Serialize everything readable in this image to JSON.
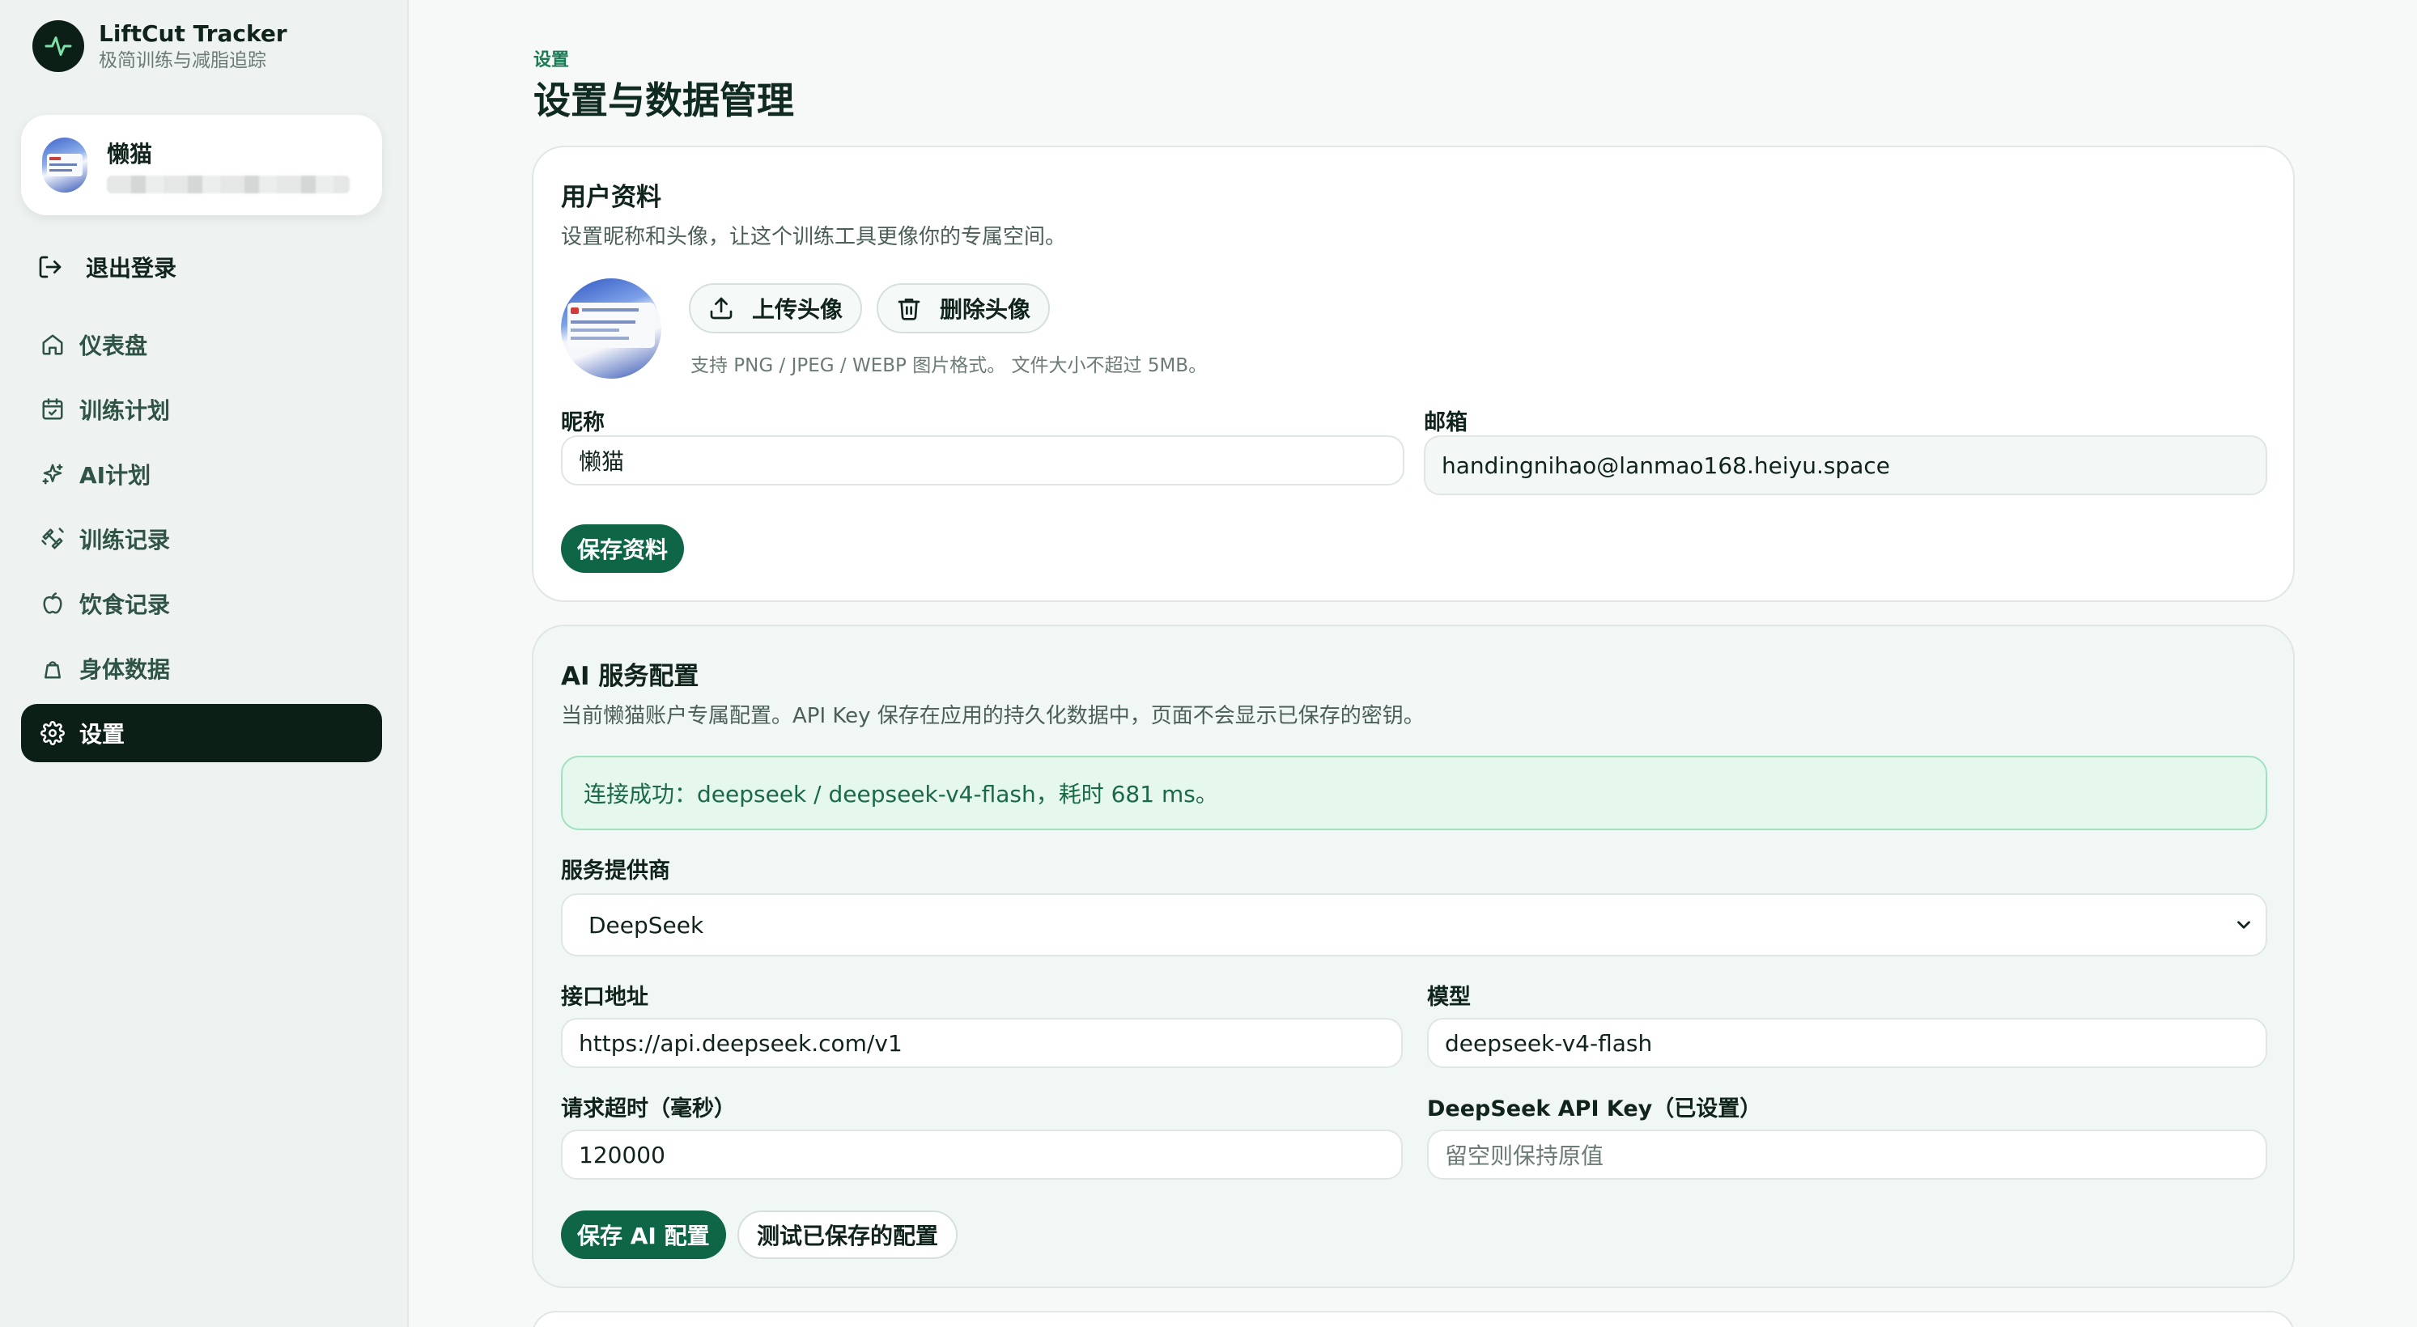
{
  "app": {
    "title": "LiftCut Tracker",
    "subtitle": "极简训练与减脂追踪"
  },
  "user": {
    "name": "懒猫"
  },
  "sidebar": {
    "logout_label": "退出登录",
    "items": [
      {
        "label": "仪表盘",
        "icon": "home-icon"
      },
      {
        "label": "训练计划",
        "icon": "calendar-icon"
      },
      {
        "label": "AI计划",
        "icon": "sparkle-icon"
      },
      {
        "label": "训练记录",
        "icon": "dumbbell-icon"
      },
      {
        "label": "饮食记录",
        "icon": "apple-icon"
      },
      {
        "label": "身体数据",
        "icon": "scale-icon"
      },
      {
        "label": "设置",
        "icon": "gear-icon",
        "active": true
      }
    ]
  },
  "page": {
    "breadcrumb": "设置",
    "title": "设置与数据管理"
  },
  "profile": {
    "title": "用户资料",
    "description": "设置昵称和头像，让这个训练工具更像你的专属空间。",
    "upload_label": "上传头像",
    "delete_label": "删除头像",
    "hint": "支持 PNG / JPEG / WEBP 图片格式。 文件大小不超过 5MB。",
    "nickname_label": "昵称",
    "nickname_value": "懒猫",
    "email_label": "邮箱",
    "email_value": "handingnihao@lanmao168.heiyu.space",
    "save_label": "保存资料"
  },
  "ai": {
    "title": "AI 服务配置",
    "description": "当前懒猫账户专属配置。API Key 保存在应用的持久化数据中，页面不会显示已保存的密钥。",
    "status": "连接成功：deepseek / deepseek-v4-flash，耗时 681 ms。",
    "provider_label": "服务提供商",
    "provider_value": "DeepSeek",
    "endpoint_label": "接口地址",
    "endpoint_value": "https://api.deepseek.com/v1",
    "model_label": "模型",
    "model_value": "deepseek-v4-flash",
    "timeout_label": "请求超时（毫秒）",
    "timeout_value": "120000",
    "apikey_label": "DeepSeek API Key（已设置）",
    "apikey_placeholder": "留空则保持原值",
    "save_label": "保存 AI 配置",
    "test_label": "测试已保存的配置"
  },
  "colors": {
    "primary": "#0e6647",
    "sidebar_active": "#0b1f16",
    "success_bg": "#e6f7ee",
    "success_text": "#1a6a47"
  }
}
